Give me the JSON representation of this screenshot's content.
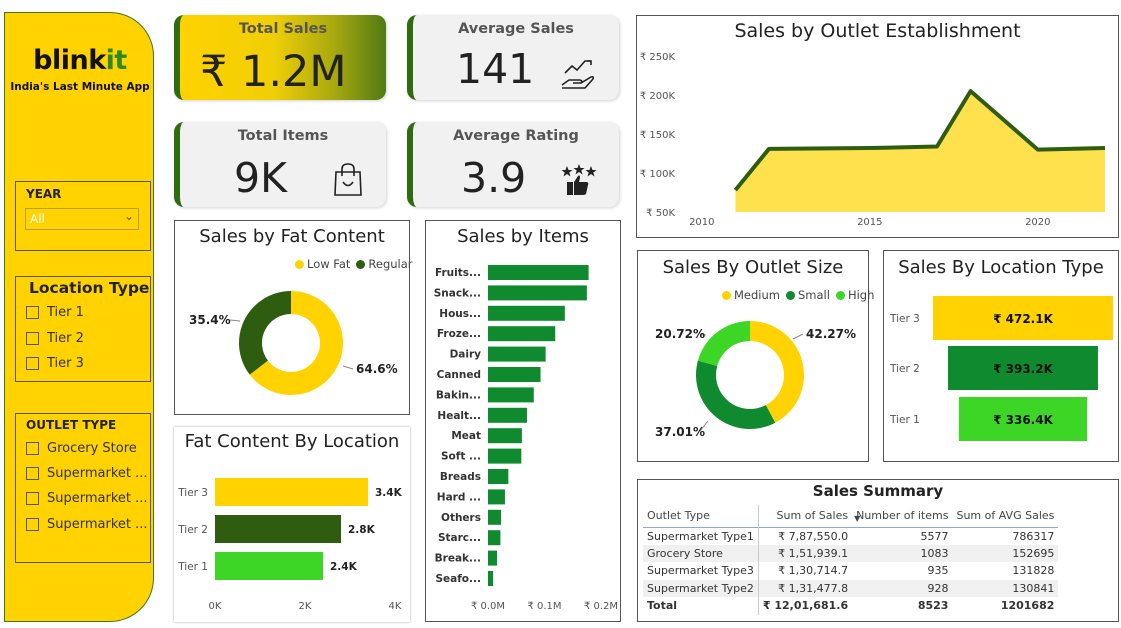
{
  "brand": {
    "logo_main": "blink",
    "logo_accent": "it",
    "tagline": "India's Last Minute App"
  },
  "filters": {
    "year": {
      "title": "YEAR",
      "selected": "All"
    },
    "location": {
      "title": "Location Type",
      "options": [
        "Tier 1",
        "Tier 2",
        "Tier 3"
      ]
    },
    "outlet": {
      "title": "OUTLET TYPE",
      "options": [
        "Grocery Store",
        "Supermarket ...",
        "Supermarket ...",
        "Supermarket ..."
      ]
    }
  },
  "kpis": {
    "total_sales": {
      "title": "Total Sales",
      "value": "₹ 1.2M"
    },
    "average_sales": {
      "title": "Average Sales",
      "value": "141"
    },
    "total_items": {
      "title": "Total Items",
      "value": "9K"
    },
    "average_rating": {
      "title": "Average Rating",
      "value": "3.9"
    }
  },
  "icons": {
    "sales": "hand-cash-icon",
    "items": "shopping-bag-icon",
    "rating": "stars-thumb-icon"
  },
  "colors": {
    "yellow": "#ffd200",
    "dark_green": "#2f5d0f",
    "green": "#0f8a2f",
    "light_green": "#3ed626"
  },
  "chart_data": [
    {
      "id": "establishment",
      "type": "area",
      "title": "Sales by Outlet Establishment",
      "x": [
        2011,
        2012,
        2015,
        2017,
        2018,
        2020,
        2022
      ],
      "values": [
        78,
        131,
        132,
        134,
        205,
        130,
        132
      ],
      "yticks": [
        "₹ 50K",
        "₹ 100K",
        "₹ 150K",
        "₹ 200K",
        "₹ 250K"
      ],
      "ytick_values": [
        50,
        100,
        150,
        200,
        250
      ],
      "xticks": [
        "2010",
        "2015",
        "2020"
      ],
      "xtick_values": [
        2010,
        2015,
        2020
      ],
      "xlim": [
        2009.5,
        2022
      ],
      "ylim": [
        50,
        250
      ]
    },
    {
      "id": "fat",
      "type": "pie",
      "title": "Sales by Fat Content",
      "categories": [
        "Low Fat",
        "Regular"
      ],
      "values": [
        64.6,
        35.4
      ],
      "labels": [
        "64.6%",
        "35.4%"
      ]
    },
    {
      "id": "items",
      "type": "bar",
      "title": "Sales by Items",
      "categories": [
        "Fruits...",
        "Snack...",
        "Hous...",
        "Froze...",
        "Dairy",
        "Canned",
        "Bakin...",
        "Healt...",
        "Meat",
        "Soft ...",
        "Breads",
        "Hard ...",
        "Others",
        "Starc...",
        "Break...",
        "Seafo..."
      ],
      "values": [
        0.178,
        0.175,
        0.136,
        0.119,
        0.102,
        0.093,
        0.081,
        0.069,
        0.06,
        0.059,
        0.036,
        0.03,
        0.023,
        0.022,
        0.016,
        0.009
      ],
      "xticks": [
        "₹ 0.0M",
        "₹ 0.1M",
        "₹ 0.2M"
      ],
      "xtick_values": [
        0,
        0.1,
        0.2
      ],
      "xlim": [
        0,
        0.2
      ]
    },
    {
      "id": "fatloc",
      "type": "bar",
      "title": "Fat Content By Location",
      "categories": [
        "Tier 3",
        "Tier 2",
        "Tier 1"
      ],
      "values": [
        3.4,
        2.8,
        2.4
      ],
      "labels": [
        "3.4K",
        "2.8K",
        "2.4K"
      ],
      "xticks": [
        "0K",
        "2K",
        "4K"
      ],
      "xtick_values": [
        0,
        2,
        4
      ],
      "xlim": [
        0,
        4
      ]
    },
    {
      "id": "size",
      "type": "pie",
      "title": "Sales By Outlet Size",
      "categories": [
        "Medium",
        "Small",
        "High"
      ],
      "values": [
        42.27,
        37.01,
        20.72
      ],
      "labels": [
        "42.27%",
        "37.01%",
        "20.72%"
      ]
    },
    {
      "id": "loctype",
      "type": "bar",
      "title": "Sales By Location Type",
      "categories": [
        "Tier 3",
        "Tier 2",
        "Tier 1"
      ],
      "values": [
        472.1,
        393.2,
        336.4
      ],
      "labels": [
        "₹ 472.1K",
        "₹ 393.2K",
        "₹ 336.4K"
      ]
    }
  ],
  "summary": {
    "title": "Sales Summary",
    "headers": [
      "Outlet Type",
      "Sum of Sales",
      "Number of items",
      "Sum of AVG Sales"
    ],
    "rows": [
      [
        "Supermarket Type1",
        "₹ 7,87,550.0",
        "5577",
        "786317"
      ],
      [
        "Grocery Store",
        "₹ 1,51,939.1",
        "1083",
        "152695"
      ],
      [
        "Supermarket Type3",
        "₹ 1,30,714.7",
        "935",
        "131828"
      ],
      [
        "Supermarket Type2",
        "₹ 1,31,477.8",
        "928",
        "130841"
      ]
    ],
    "total": [
      "Total",
      "₹ 12,01,681.6",
      "8523",
      "1201682"
    ]
  }
}
